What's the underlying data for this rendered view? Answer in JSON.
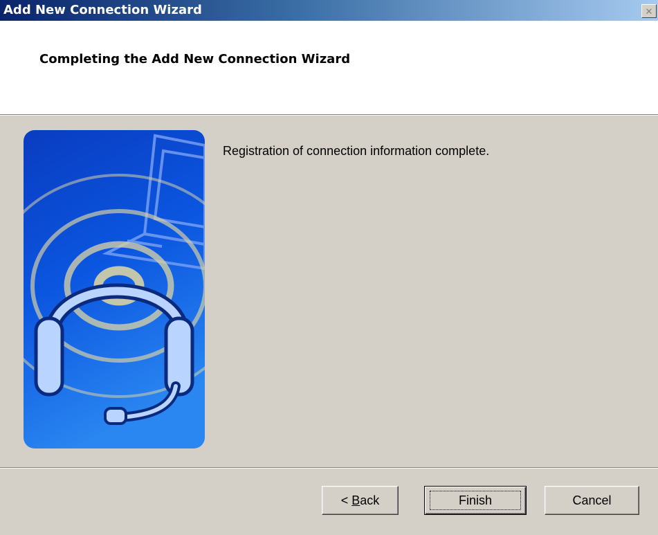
{
  "window": {
    "title": "Add New Connection Wizard",
    "close_glyph": "✕"
  },
  "header": {
    "title": "Completing the Add New Connection Wizard"
  },
  "body": {
    "message": "Registration of connection information complete."
  },
  "illustration": {
    "icon": "headset-laptop-wireless-illustration",
    "colors": {
      "background": "#0a44c8",
      "rings": "#d8d2a6",
      "headset": "#b8d4ff"
    }
  },
  "buttons": {
    "back_prefix": "< ",
    "back_mnemonic": "B",
    "back_rest": "ack",
    "finish": "Finish",
    "cancel": "Cancel"
  },
  "colors": {
    "titlebar_start": "#0a246a",
    "titlebar_end": "#a6caf0",
    "face": "#d4d0c8"
  }
}
